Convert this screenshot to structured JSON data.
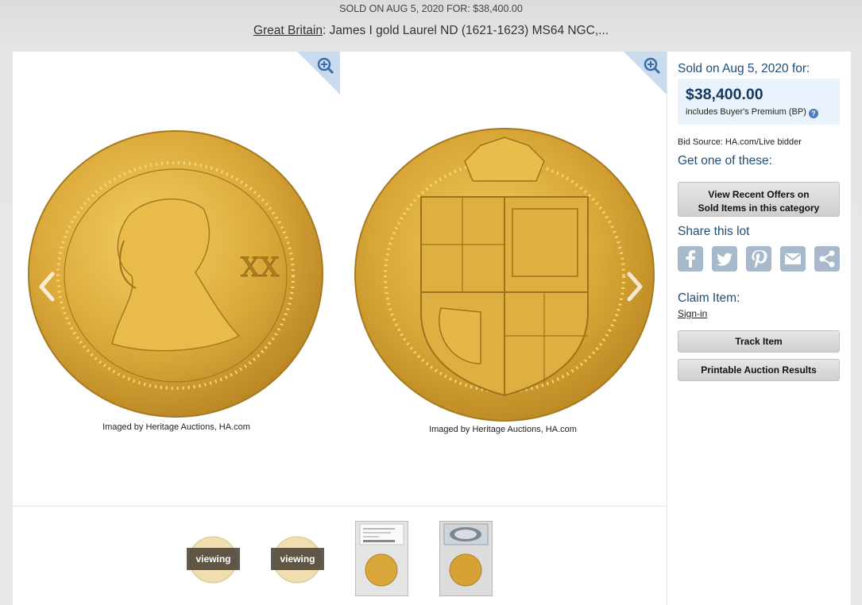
{
  "header": {
    "sold_line": "SOLD ON AUG 5, 2020 FOR: $38,400.00",
    "category_link": "Great Britain",
    "title_rest": ": James I gold Laurel ND (1621-1623) MS64 NGC,..."
  },
  "gallery": {
    "left_credit": "Imaged by Heritage Auctions, HA.com",
    "right_credit": "Imaged by Heritage Auctions, HA.com",
    "thumbnails": [
      {
        "badge": "viewing",
        "icon": "coin-obverse-thumbnail"
      },
      {
        "badge": "viewing",
        "icon": "coin-reverse-thumbnail"
      },
      {
        "badge": "",
        "icon": "slab-front-thumbnail"
      },
      {
        "badge": "",
        "icon": "slab-back-thumbnail"
      }
    ],
    "icons": [
      "zoom-in-icon",
      "chevron-left-icon",
      "chevron-right-icon"
    ]
  },
  "sidebar": {
    "sold_label": "Sold on Aug 5, 2020 for:",
    "price": "$38,400.00",
    "bp_text": "includes Buyer's Premium (BP)",
    "help": "?",
    "bid_source": "Bid Source: HA.com/Live bidder",
    "get_one": "Get one of these:",
    "offers_line1": "View Recent Offers on",
    "offers_line2": "Sold Items in this category",
    "share_label": "Share this lot",
    "share_icons": [
      "facebook-icon",
      "twitter-icon",
      "pinterest-icon",
      "email-icon",
      "share-icon"
    ],
    "claim_label": "Claim Item:",
    "sign_in": "Sign-in",
    "track_button": "Track Item",
    "print_button": "Printable Auction Results"
  },
  "colors": {
    "accent_text": "#1f4e79",
    "price_box": "#eaf3fb",
    "gold": "#d9a92e",
    "share_icon": "#a8b9cc"
  }
}
